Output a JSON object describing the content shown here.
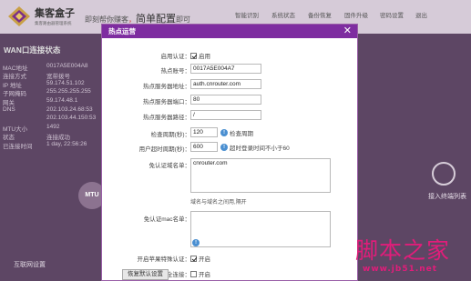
{
  "header": {
    "logo_name": "集客盒子",
    "logo_sub": "集客路由器管理系统",
    "slogan_prefix": "即刻帮你赚客",
    "slogan_highlight": "，",
    "slogan_main": "简单配置",
    "slogan_tail": "即可",
    "nav": [
      "智能识别",
      "系统状态",
      "备份恢复",
      "固件升级",
      "密码设置",
      "退出"
    ]
  },
  "wan": {
    "title": "WAN口连接状态",
    "rows": [
      {
        "label": "MAC地址",
        "value": "0017A5E004A8"
      },
      {
        "label": "连接方式",
        "value": "宽带拨号"
      },
      {
        "label": "IP 地址",
        "value": "59.174.51.102"
      },
      {
        "label": "子网掩码",
        "value": "255.255.255.255"
      },
      {
        "label": "网关",
        "value": "59.174.48.1"
      },
      {
        "label": "DNS",
        "value": "202.103.24.68:53"
      },
      {
        "label": "",
        "value": "202.103.44.150:53"
      },
      {
        "label": "MTU大小",
        "value": "1492"
      },
      {
        "label": "状态",
        "value": "连接成功"
      },
      {
        "label": "已连接时间",
        "value": "1 day, 22:56:26"
      }
    ],
    "mtu_badge": "MTU",
    "bottom_left": "互联网设置",
    "right_label": "接入终端列表"
  },
  "modal": {
    "title": "热点运营",
    "close": "✕",
    "enable_label": "启用认证：",
    "enable_text": "启用",
    "hotspot_id_label": "热点账号：",
    "hotspot_id": "0017A5E004A7",
    "server_addr_label": "热点服务器地址：",
    "server_addr": "auth.cnrouter.com",
    "server_port_label": "热点服务器端口：",
    "server_port": "80",
    "server_path_label": "热点服务器路径：",
    "server_path": "/",
    "check_period_label": "检查周期(秒)：",
    "check_period": "120",
    "check_period_hint": "检查周期",
    "timeout_label": "用户超时周期(秒)：",
    "timeout": "600",
    "timeout_hint": "超时登录时间不小于60",
    "whitelist_domain_label": "免认证域名单：",
    "whitelist_domain": "cnrouter.com",
    "whitelist_domain_note": "域名与域名之间用,隔开",
    "whitelist_mac_label": "免认证mac名单：",
    "whitelist_mac": "",
    "apple_label": "开启苹果特殊认证：",
    "apple_text": "开启",
    "ssl_label": "开启ssl安全连接：",
    "ssl_text": "开启",
    "reset_button": "恢复默认设置"
  },
  "watermark": {
    "cn": "脚本之家",
    "url": "www.jb51.net"
  }
}
